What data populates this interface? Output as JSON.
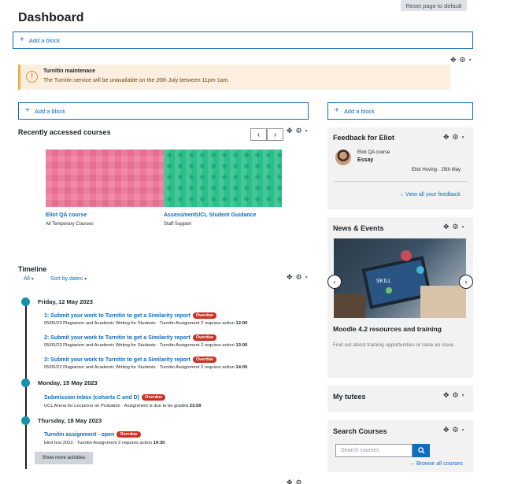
{
  "header": {
    "reset_label": "Reset page to default",
    "title": "Dashboard"
  },
  "add_block_label": "Add a block",
  "alert": {
    "title": "Turnitin maintenace",
    "message": "The Turnitin service will be unavailable on the 26th July between 11pm-1am."
  },
  "recent_courses": {
    "title": "Recently accessed courses",
    "prev": "‹",
    "next": "›",
    "items": [
      {
        "name": "Eliot QA course",
        "category": "All Temporary Courses"
      },
      {
        "name": "AssessmentUCL Student Guidance",
        "category": "Staff Support"
      }
    ]
  },
  "timeline": {
    "title": "Timeline",
    "filter_all": "All",
    "sort_label": "Sort by dates",
    "overdue_label": "Overdue",
    "groups": [
      {
        "date": "Friday, 12 May 2023",
        "events": [
          {
            "title": "1: Submit your work to Turnitin to get a Similarity report",
            "overdue": true,
            "sub": "05/05/23 Plagiarism and Academic Writing for Students · Turnitin Assignment 2 requires action",
            "time": "12:00"
          },
          {
            "title": "2: Submit your work to Turnitin to get a Similarity report",
            "overdue": true,
            "sub": "05/05/23 Plagiarism and Academic Writing for Students · Turnitin Assignment 2 requires action",
            "time": "13:00"
          },
          {
            "title": "3: Submit your work to Turnitin to get a Similarity report",
            "overdue": true,
            "sub": "05/05/23 Plagiarism and Academic Writing for Students · Turnitin Assignment 2 requires action",
            "time": "14:00"
          }
        ]
      },
      {
        "date": "Monday, 15 May 2023",
        "events": [
          {
            "title": "Submission inbox (cohorts C and D)",
            "overdue": true,
            "sub": "UCL Arena for Lecturers on Probation · Assignment is due to be graded",
            "time": "23:59"
          }
        ]
      },
      {
        "date": "Thursday, 18 May 2023",
        "events": [
          {
            "title": "Turnitin assignment - open",
            "overdue": true,
            "sub": "Eliot test 2022 · Turnitin Assignment 2 requires action",
            "time": "14:30"
          }
        ]
      }
    ],
    "show_more": "Show more activities"
  },
  "feedback": {
    "title": "Feedback for Eliot",
    "course": "Eliot QA course",
    "item": "Essay",
    "meta": "Eliot Hoving · 25th May",
    "link": "View all your feedback"
  },
  "news": {
    "title": "News & Events",
    "image_texts": [
      "SKILL"
    ],
    "headline": "Moodle 4.2 resources and training",
    "description": "Find out about training opportunities or raise an issue."
  },
  "tutees": {
    "title": "My tutees"
  },
  "search": {
    "title": "Search Courses",
    "placeholder": "Search courses",
    "link": "Browse all courses"
  },
  "icons": {
    "plus": "+",
    "move": "✥",
    "gear": "⚙",
    "caret": "▾",
    "arrow_right": "→",
    "search": "🔍",
    "warning": "!"
  }
}
